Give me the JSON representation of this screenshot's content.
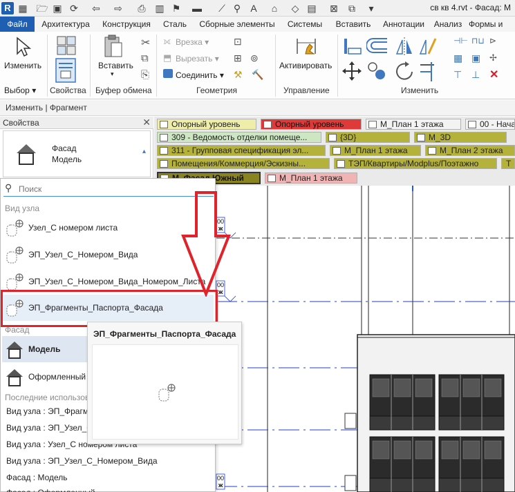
{
  "qat": {
    "app_logo": "R",
    "title": "св кв 4.rvt - Фасад: M"
  },
  "tabs": [
    {
      "label": "Файл",
      "active": true
    },
    {
      "label": "Архитектура"
    },
    {
      "label": "Конструкция"
    },
    {
      "label": "Сталь"
    },
    {
      "label": "Сборные элементы"
    },
    {
      "label": "Системы"
    },
    {
      "label": "Вставить"
    },
    {
      "label": "Аннотации"
    },
    {
      "label": "Анализ"
    },
    {
      "label": "Формы и"
    }
  ],
  "ribbon": {
    "modify_label": "Изменить",
    "paste_label": "Вставить",
    "cut_label": "Врезка",
    "cutout_label": "Вырезать",
    "join_label": "Соединить",
    "activate_label": "Активировать",
    "groups": {
      "select": "Выбор",
      "properties": "Свойства",
      "clipboard": "Буфер обмена",
      "geometry": "Геометрия",
      "control": "Управление",
      "modify": "Изменить"
    }
  },
  "context_bar": "Изменить | Фрагмент",
  "properties": {
    "title": "Свойства",
    "type_family": "Фасад",
    "type_name": "Модель"
  },
  "dropdown": {
    "search_placeholder": "Поиск",
    "category_detail": "Вид узла",
    "detail_items": [
      "Узел_С номером листа",
      "ЭП_Узел_С_Номером_Вида",
      "ЭП_Узел_С_Номером_Вида_Номером_Листа",
      "ЭП_Фрагменты_Паспорта_Фасада"
    ],
    "category_facade": "Фасад",
    "facade_items": [
      "Модель",
      "Оформленный"
    ],
    "category_recent": "Последние использов",
    "recent_items": [
      "Вид узла : ЭП_Фрагме",
      "Вид узла : ЭП_Узел_С",
      "Вид узла : Узел_С номером листа",
      "Вид узла : ЭП_Узел_С_Номером_Вида",
      "Фасад : Модель",
      "Фасад : Оформленный"
    ]
  },
  "tooltip": {
    "title": "ЭП_Фрагменты_Паспорта_Фасада"
  },
  "view_tabs": [
    {
      "label": "Опорный уровень"
    },
    {
      "label": "Опорный уровень"
    },
    {
      "label": "М_План 1 этажа"
    },
    {
      "label": "00 - Нача"
    },
    {
      "label": "309 - Ведомость отделки помеще..."
    },
    {
      "label": "{3D}"
    },
    {
      "label": "М_3D"
    },
    {
      "label": "311 - Групповая спецификация эл..."
    },
    {
      "label": "М_План 1 этажа"
    },
    {
      "label": "М_План 2 этажа"
    },
    {
      "label": "Помещения/Коммерция/Эскизны..."
    },
    {
      "label": "ТЭП/Квартиры/Modplus/Поэтажно"
    },
    {
      "label": "Т"
    },
    {
      "label": "М_Фасад Южный"
    },
    {
      "label": "М_План 1 этажа"
    }
  ],
  "canvas": {
    "level_tags": [
      "00",
      "00",
      "00"
    ],
    "level_marks": [
      "ж",
      "ж",
      "ж"
    ]
  }
}
